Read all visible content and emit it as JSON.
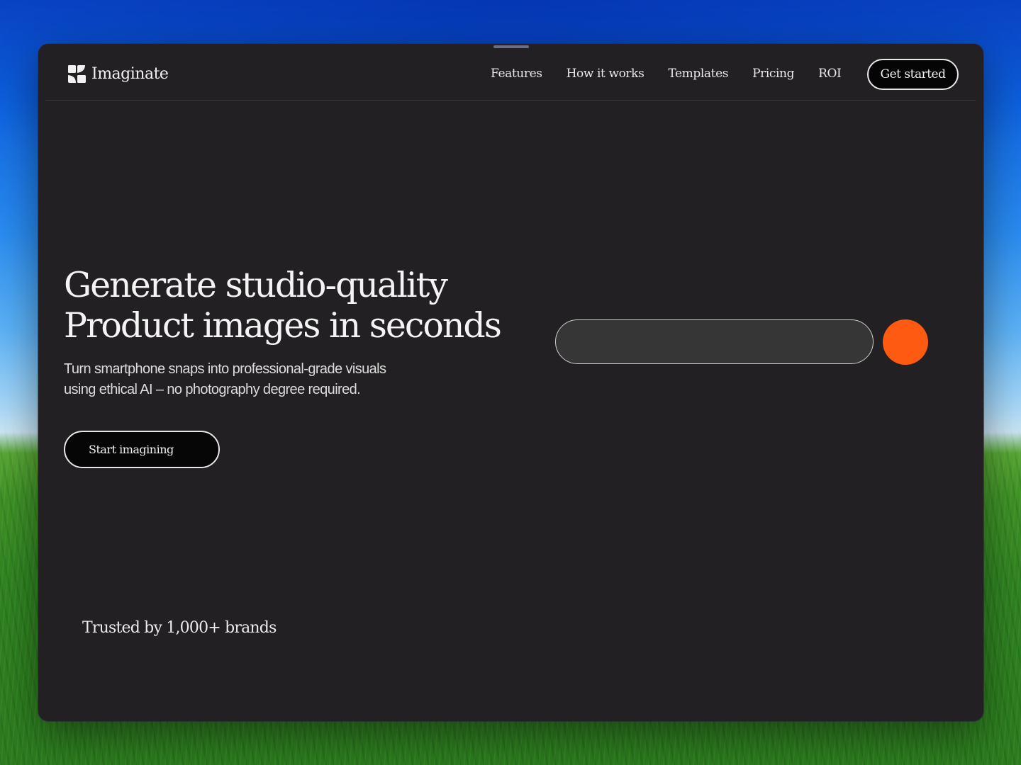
{
  "brand": {
    "name": "Imaginate",
    "logo_icon": "four-tile-logo-icon"
  },
  "nav": {
    "links": [
      {
        "label": "Features"
      },
      {
        "label": "How it works"
      },
      {
        "label": "Templates"
      },
      {
        "label": "Pricing"
      },
      {
        "label": "ROI"
      }
    ],
    "cta_label": "Get started"
  },
  "hero": {
    "title_line1": "Generate studio-quality",
    "title_line2": "Product images in seconds",
    "subtitle_line1": "Turn smartphone snaps into professional-grade visuals",
    "subtitle_line2": "using ethical AI – no photography degree required.",
    "start_button_label": "Start imagining"
  },
  "prompt": {
    "value": "",
    "placeholder": "",
    "submit_color": "#ff5a12"
  },
  "trust": {
    "text": "Trusted by 1,000+ brands"
  },
  "colors": {
    "page_background": "#222022",
    "accent": "#ff5a12",
    "text": "#f4f4f4"
  }
}
